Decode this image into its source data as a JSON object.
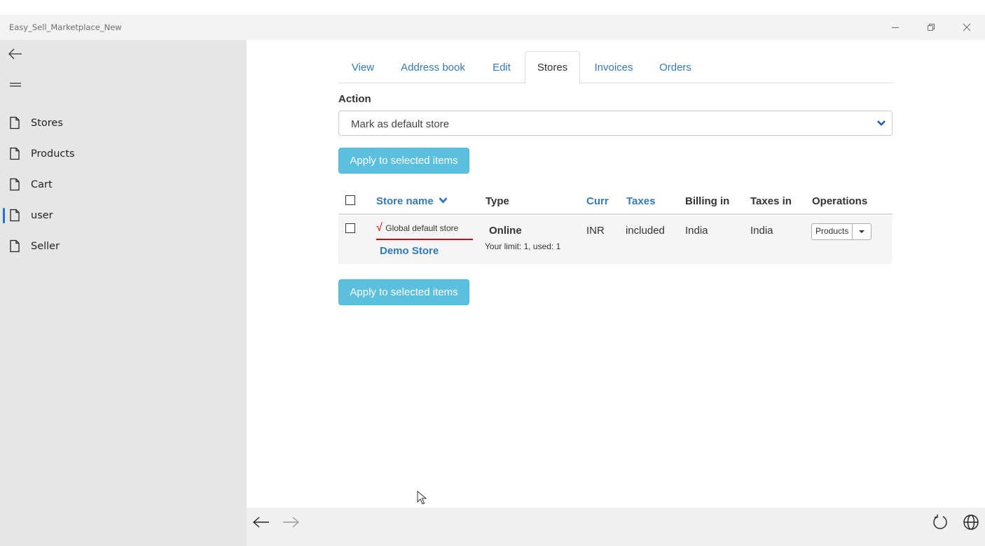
{
  "window": {
    "title": "Easy_Sell_Marketplace_New"
  },
  "sidebar": {
    "items": [
      {
        "label": "Stores",
        "active": false
      },
      {
        "label": "Products",
        "active": false
      },
      {
        "label": "Cart",
        "active": false
      },
      {
        "label": "user",
        "active": true
      },
      {
        "label": "Seller",
        "active": false
      }
    ]
  },
  "tabs": [
    {
      "label": "View",
      "active": false
    },
    {
      "label": "Address book",
      "active": false
    },
    {
      "label": "Edit",
      "active": false
    },
    {
      "label": "Stores",
      "active": true
    },
    {
      "label": "Invoices",
      "active": false
    },
    {
      "label": "Orders",
      "active": false
    }
  ],
  "action": {
    "label": "Action",
    "selected": "Mark as default store",
    "apply_label": "Apply to selected items"
  },
  "table": {
    "columns": {
      "store_name": "Store name",
      "type": "Type",
      "curr": "Curr",
      "taxes": "Taxes",
      "billing_in": "Billing in",
      "taxes_in": "Taxes in",
      "operations": "Operations"
    },
    "rows": [
      {
        "default_mark": "√",
        "default_label": "Global default store",
        "store_name": "Demo Store",
        "type": "Online",
        "limit": "Your limit: 1, used: 1",
        "curr": "INR",
        "taxes": "included",
        "billing_in": "India",
        "taxes_in": "India",
        "operation_button": "Products"
      }
    ]
  },
  "colors": {
    "accent": "#337ab7",
    "button": "#5bc0de",
    "default_mark": "#e00000",
    "nav_active": "#1a73d9"
  }
}
